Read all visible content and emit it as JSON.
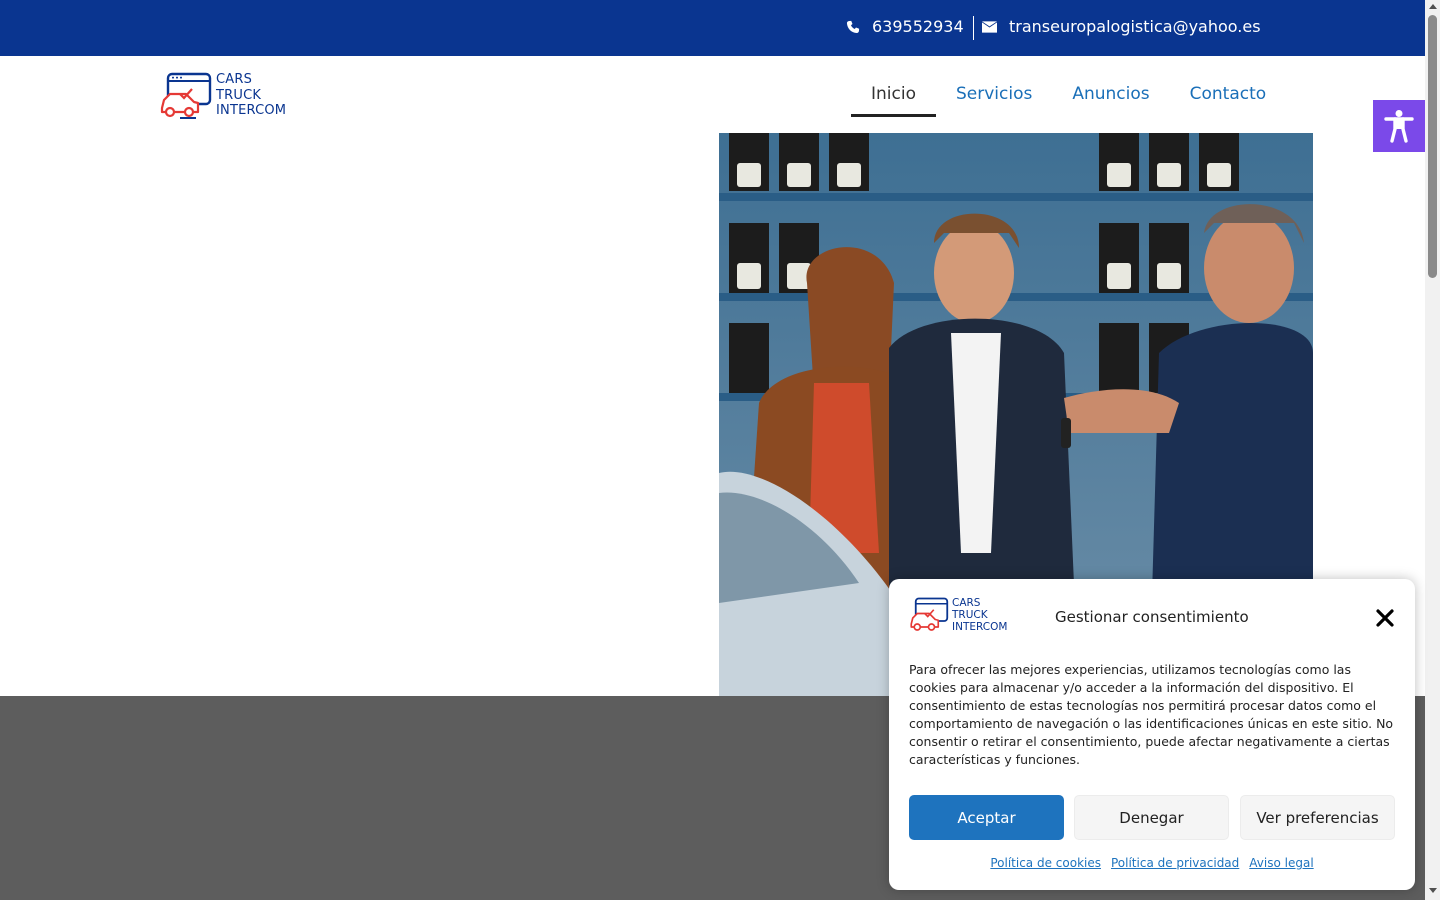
{
  "topbar": {
    "phone": "639552934",
    "email": "transeuropalogistica@yahoo.es",
    "background": "#0a3590"
  },
  "logo": {
    "line1": "CARS",
    "line2": "TRUCK",
    "line3": "INTERCOM"
  },
  "nav": {
    "items": [
      {
        "label": "Inicio",
        "active": true
      },
      {
        "label": "Servicios",
        "active": false
      },
      {
        "label": "Anuncios",
        "active": false
      },
      {
        "label": "Contacto",
        "active": false
      }
    ]
  },
  "icons": {
    "phone": "phone-icon",
    "email": "envelope-icon",
    "accessibility": "accessibility-icon",
    "close": "close-icon"
  },
  "cookie": {
    "title": "Gestionar consentimiento",
    "body": "Para ofrecer las mejores experiencias, utilizamos tecnologías como las cookies para almacenar y/o acceder a la información del dispositivo. El consentimiento de estas tecnologías nos permitirá procesar datos como el comportamiento de navegación o las identificaciones únicas en este sitio. No consentir o retirar el consentimiento, puede afectar negativamente a ciertas características y funciones.",
    "accept": "Aceptar",
    "deny": "Denegar",
    "preferences": "Ver preferencias",
    "links": [
      "Política de cookies",
      "Política de privacidad",
      "Aviso legal"
    ]
  },
  "colors": {
    "brand": "#0a3590",
    "accent": "#1e73be",
    "accessibility": "#7b49e9",
    "footer": "#5d5d5d"
  }
}
